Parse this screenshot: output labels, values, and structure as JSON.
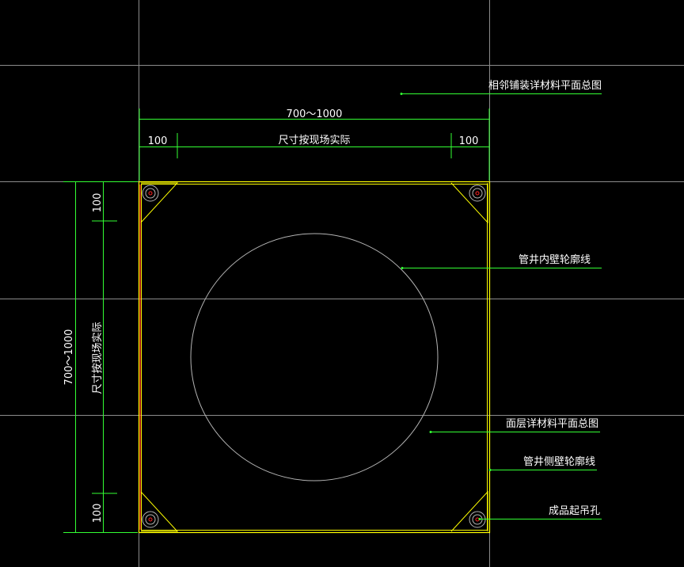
{
  "colors": {
    "background": "#000000",
    "grid": "#8c8c8c",
    "dimension": "#33ff33",
    "outline": "#ffff00",
    "leader": "#33ff33",
    "text": "#ffffff",
    "circle": "#b4b4b4",
    "hole_dot": "#ff2020",
    "left_edge": "#ff2020"
  },
  "dimensions": {
    "top_overall": "700～1000",
    "top_left_offset": "100",
    "top_middle": "尺寸按现场实际",
    "top_right_offset": "100",
    "left_overall": "700～1000",
    "left_top_offset": "100",
    "left_middle": "尺寸按现场实际",
    "left_bottom_offset": "100"
  },
  "labels": {
    "adjacent_paving": "相邻铺装详材料平面总图",
    "inner_wall": "管井内壁轮廓线",
    "surface_layer": "面层详材料平面总图",
    "outer_wall": "管井侧壁轮廓线",
    "lifting_hole": "成品起吊孔"
  }
}
